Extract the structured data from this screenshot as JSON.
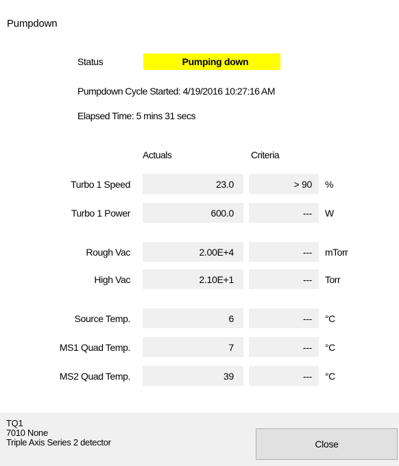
{
  "window": {
    "title": "Pumpdown"
  },
  "status": {
    "label": "Status",
    "value": "Pumping down",
    "color": "#ffff00"
  },
  "cycle_started": "Pumpdown Cycle Started: 4/19/2016 10:27:16 AM",
  "elapsed_time": "Elapsed Time: 5 mins 31 secs",
  "columns": {
    "actuals": "Actuals",
    "criteria": "Criteria"
  },
  "rows": [
    {
      "label": "Turbo 1 Speed",
      "actual": "23.0",
      "criteria": "> 90",
      "unit": "%"
    },
    {
      "label": "Turbo 1 Power",
      "actual": "600.0",
      "criteria": "---",
      "unit": "W"
    },
    {
      "label": "Rough Vac",
      "actual": "2.00E+4",
      "criteria": "---",
      "unit": "mTorr"
    },
    {
      "label": "High Vac",
      "actual": "2.10E+1",
      "criteria": "---",
      "unit": "Torr"
    },
    {
      "label": "Source Temp.",
      "actual": "6",
      "criteria": "---",
      "unit": "°C"
    },
    {
      "label": "MS1 Quad Temp.",
      "actual": "7",
      "criteria": "---",
      "unit": "°C"
    },
    {
      "label": "MS2 Quad Temp.",
      "actual": "39",
      "criteria": "---",
      "unit": "°C"
    }
  ],
  "footer": {
    "device_lines": [
      "TQ1",
      "7010  None",
      "Triple Axis Series 2 detector"
    ],
    "close_label": "Close"
  }
}
